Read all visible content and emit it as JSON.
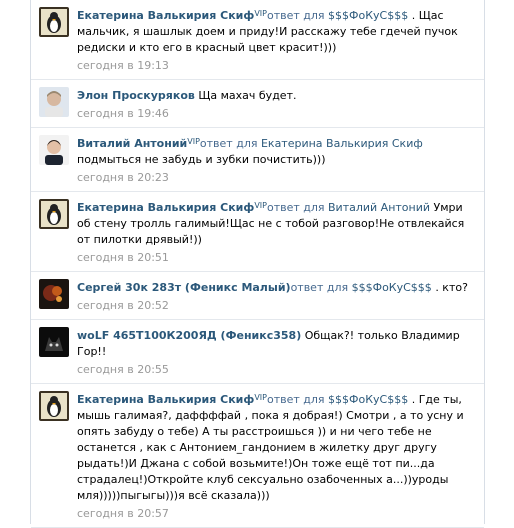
{
  "posts": [
    {
      "author": "",
      "vip": "",
      "reply_prefix": "",
      "reply_to": "",
      "text": "",
      "time": "сегодня в 19:13",
      "avatar": "penguin-avatar",
      "partial": true
    },
    {
      "author": "Екатерина Валькирия Скиф",
      "vip": "VIP",
      "reply_prefix": "ответ для",
      "reply_to": "$$$ФоКуС$$$",
      "text": ". Щас мальчик, я шашлык доем и приду!И расскажу тебе гдечей пучок редиски и кто его в красный цвет красит!)))",
      "time": "сегодня в 19:13",
      "avatar": "penguin-avatar"
    },
    {
      "author": "Элон Проскуряков",
      "vip": "",
      "reply_prefix": "",
      "reply_to": "",
      "text": "Ща махач будет.",
      "time": "сегодня в 19:46",
      "avatar": "man-avatar"
    },
    {
      "author": "Виталий Антоний",
      "vip": "VIP",
      "reply_prefix": "ответ для",
      "reply_to": "Екатерина Валькирия Скиф",
      "text": "подмыться не забудь и зубки почистить)))",
      "time": "сегодня в 20:23",
      "avatar": "portrait-avatar"
    },
    {
      "author": "Екатерина Валькирия Скиф",
      "vip": "VIP",
      "reply_prefix": "ответ для",
      "reply_to": "Виталий Антоний",
      "text": "Умри об стену тролль галимый!Щас не с тобой разговор!Не отвлекайся от пилотки дрявый!))",
      "time": "сегодня в 20:51",
      "avatar": "penguin-avatar"
    },
    {
      "author": "Сергей 30к 283т (Феникс Малый)",
      "vip": "",
      "reply_prefix": "ответ для",
      "reply_to": "$$$ФоКуС$$$",
      "text": ". кто?",
      "time": "сегодня в 20:52",
      "avatar": "dark-avatar"
    },
    {
      "author": "woLF 465Т100К200ЯД (Феникс358)",
      "vip": "",
      "reply_prefix": "",
      "reply_to": "",
      "text": "Общак?! только Владимир Гор!!",
      "time": "сегодня в 20:55",
      "avatar": "wolf-avatar"
    },
    {
      "author": "Екатерина Валькирия Скиф",
      "vip": "VIP",
      "reply_prefix": "ответ для",
      "reply_to": "$$$ФоКуС$$$",
      "text": ". Где ты, мышь галимая?, даффффай , пока я добрая!) Смотри , а то усну и опять забуду о тебе) А ты расстроишься )) и ни чего тебе не останется , как с Антонием_гандонием в жилетку друг другу рыдать!)И Джана с собой возьмите!)Он тоже ещё тот пи...да страдалец!)Откройте клуб сексуально озабоченных а...))уроды мля)))))пыгыгы)))я всё сказала)))",
      "time": "сегодня в 20:57",
      "avatar": "penguin-avatar"
    }
  ]
}
